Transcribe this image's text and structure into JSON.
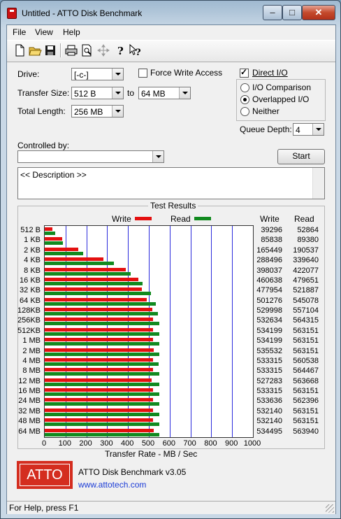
{
  "window": {
    "title": "Untitled - ATTO Disk Benchmark"
  },
  "menu": [
    "File",
    "View",
    "Help"
  ],
  "toolbar_icons": [
    "new-icon",
    "open-icon",
    "save-icon",
    "print-icon",
    "print-preview-icon",
    "move-icon",
    "help-icon",
    "context-help-icon"
  ],
  "drive": {
    "label": "Drive:",
    "value": "[-c-]"
  },
  "force_write": {
    "label": "Force Write Access",
    "checked": false
  },
  "direct_io": {
    "label": "Direct I/O",
    "checked": true
  },
  "transfer": {
    "label": "Transfer Size:",
    "from": "512 B",
    "to_label": "to",
    "to": "64 MB"
  },
  "total_length": {
    "label": "Total Length:",
    "value": "256 MB"
  },
  "io_mode": {
    "comparison": {
      "label": "I/O Comparison",
      "selected": false
    },
    "overlapped": {
      "label": "Overlapped I/O",
      "selected": true
    },
    "neither": {
      "label": "Neither",
      "selected": false
    }
  },
  "queue_depth": {
    "label": "Queue Depth:",
    "value": "4"
  },
  "controlled_by": {
    "label": "Controlled by:",
    "value": ""
  },
  "start_button": "Start",
  "description": "<< Description >>",
  "results": {
    "title": "Test Results",
    "legend_write": "Write",
    "legend_read": "Read",
    "col_write": "Write",
    "col_read": "Read",
    "xlabel": "Transfer Rate - MB / Sec",
    "colors": {
      "write": "#e41010",
      "read": "#118a1f",
      "grid": "#2a2adc"
    }
  },
  "chart_data": {
    "type": "bar",
    "orientation": "horizontal",
    "title": "Test Results",
    "xlabel": "Transfer Rate - MB / Sec",
    "xlim": [
      0,
      1000
    ],
    "xticks": [
      "0",
      "100",
      "200",
      "300",
      "400",
      "500",
      "600",
      "700",
      "800",
      "900",
      "1000"
    ],
    "grid": true,
    "legend_placement": "top",
    "categories": [
      "512 B",
      "1 KB",
      "2 KB",
      "4 KB",
      "8 KB",
      "16 KB",
      "32 KB",
      "64 KB",
      "128KB",
      "256KB",
      "512KB",
      "1 MB",
      "2 MB",
      "4 MB",
      "8 MB",
      "12 MB",
      "16 MB",
      "24 MB",
      "32 MB",
      "48 MB",
      "64 MB"
    ],
    "series": [
      {
        "name": "Write",
        "values": [
          39296,
          85838,
          165449,
          288496,
          398037,
          460638,
          477954,
          501276,
          529998,
          532634,
          534199,
          534199,
          535532,
          533315,
          533315,
          527283,
          533315,
          533636,
          532140,
          532140,
          534495
        ]
      },
      {
        "name": "Read",
        "values": [
          52864,
          89380,
          190537,
          339640,
          422077,
          479651,
          521887,
          545078,
          557104,
          564315,
          563151,
          563151,
          563151,
          560538,
          564467,
          563668,
          563151,
          562396,
          563151,
          563151,
          563940
        ]
      }
    ],
    "value_units": "KB/s"
  },
  "footer": {
    "logo": "ATTO",
    "version": "ATTO Disk Benchmark v3.05",
    "url": "www.attotech.com"
  },
  "status": "For Help, press F1"
}
